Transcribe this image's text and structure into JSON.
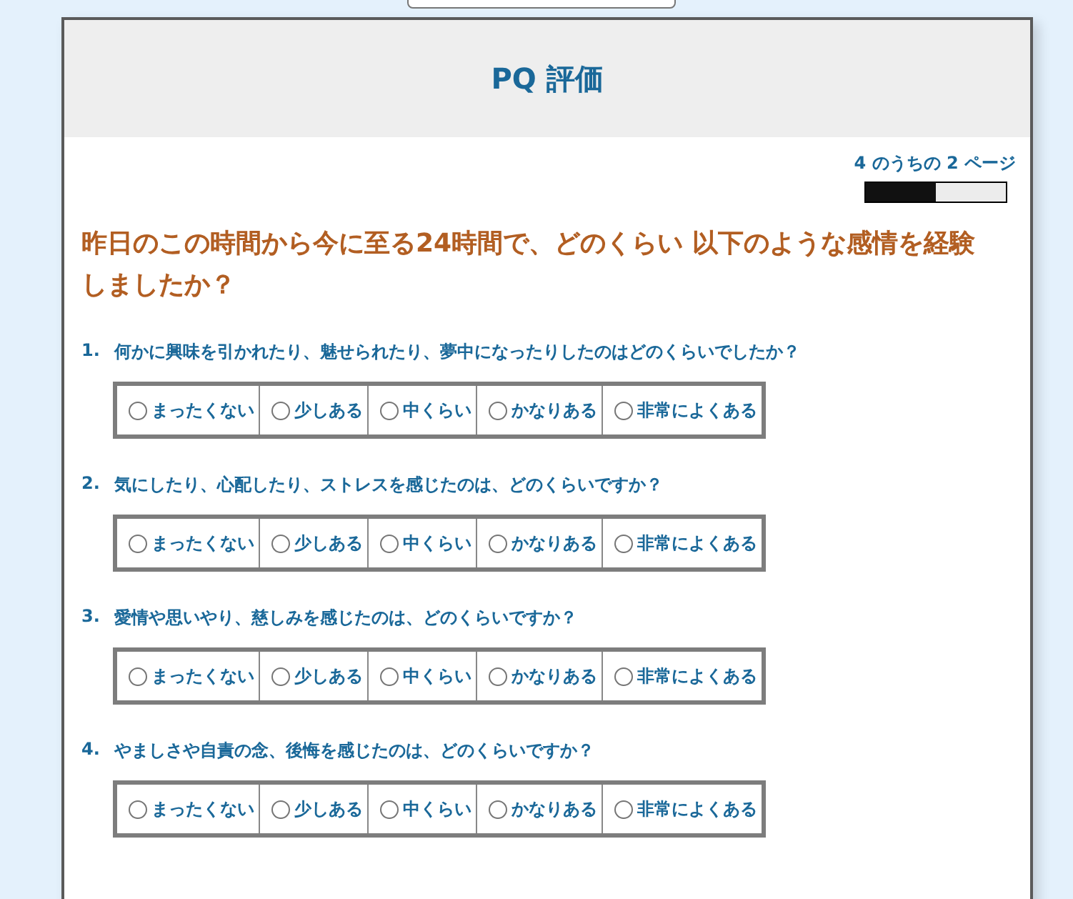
{
  "title": "PQ 評価",
  "progress": {
    "text": "4 のうちの 2 ページ",
    "level": 0.5
  },
  "heading": "昨日のこの時間から今に至る24時間で、どのくらい 以下のような感情を経験しましたか？",
  "questions": [
    {
      "number": "1.",
      "text": "何かに興味を引かれたり、魅せられたり、夢中になったりしたのはどのくらいでしたか？",
      "options": [
        {
          "label": "まったくない",
          "selected": false
        },
        {
          "label": "少しある",
          "selected": false
        },
        {
          "label": "中くらい",
          "selected": false
        },
        {
          "label": "かなりある",
          "selected": false
        },
        {
          "label": "非常によくある",
          "selected": false
        }
      ]
    },
    {
      "number": "2.",
      "text": "気にしたり、心配したり、ストレスを感じたのは、どのくらいですか？",
      "options": [
        {
          "label": "まったくない",
          "selected": false
        },
        {
          "label": "少しある",
          "selected": false
        },
        {
          "label": "中くらい",
          "selected": false
        },
        {
          "label": "かなりある",
          "selected": false
        },
        {
          "label": "非常によくある",
          "selected": false
        }
      ]
    },
    {
      "number": "3.",
      "text": "愛情や思いやり、慈しみを感じたのは、どのくらいですか？",
      "options": [
        {
          "label": "まったくない",
          "selected": false
        },
        {
          "label": "少しある",
          "selected": false
        },
        {
          "label": "中くらい",
          "selected": false
        },
        {
          "label": "かなりある",
          "selected": false
        },
        {
          "label": "非常によくある",
          "selected": false
        }
      ]
    },
    {
      "number": "4.",
      "text": "やましさや自責の念、後悔を感じたのは、どのくらいですか？",
      "options": [
        {
          "label": "まったくない",
          "selected": false
        },
        {
          "label": "少しある",
          "selected": false
        },
        {
          "label": "中くらい",
          "selected": false
        },
        {
          "label": "かなりある",
          "selected": false
        },
        {
          "label": "非常によくある",
          "selected": false
        }
      ]
    }
  ]
}
